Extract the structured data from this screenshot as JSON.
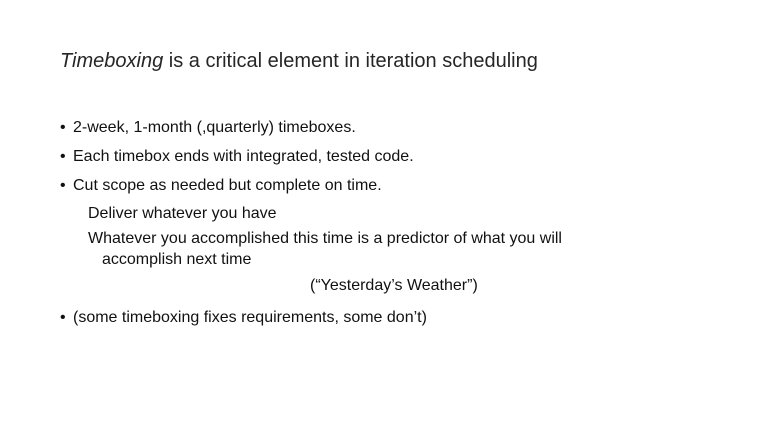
{
  "title": {
    "emphasis": "Timeboxing",
    "rest": " is a critical element in iteration scheduling"
  },
  "bullets": [
    {
      "glyph": "•",
      "text": "2-week, 1-month (,quarterly) timeboxes."
    },
    {
      "glyph": "•",
      "text": "Each timebox ends with integrated, tested code."
    },
    {
      "glyph": "•",
      "text": "Cut scope as needed but complete on time."
    },
    {
      "glyph": "•",
      "text": "(some timeboxing fixes requirements, some don’t)"
    }
  ],
  "sub_items": {
    "deliver": "Deliver whatever you have",
    "predictor_line1": "Whatever you accomplished this time is a predictor of what you will",
    "predictor_line2": "accomplish next time",
    "weather": "(“Yesterday’s Weather”)"
  }
}
